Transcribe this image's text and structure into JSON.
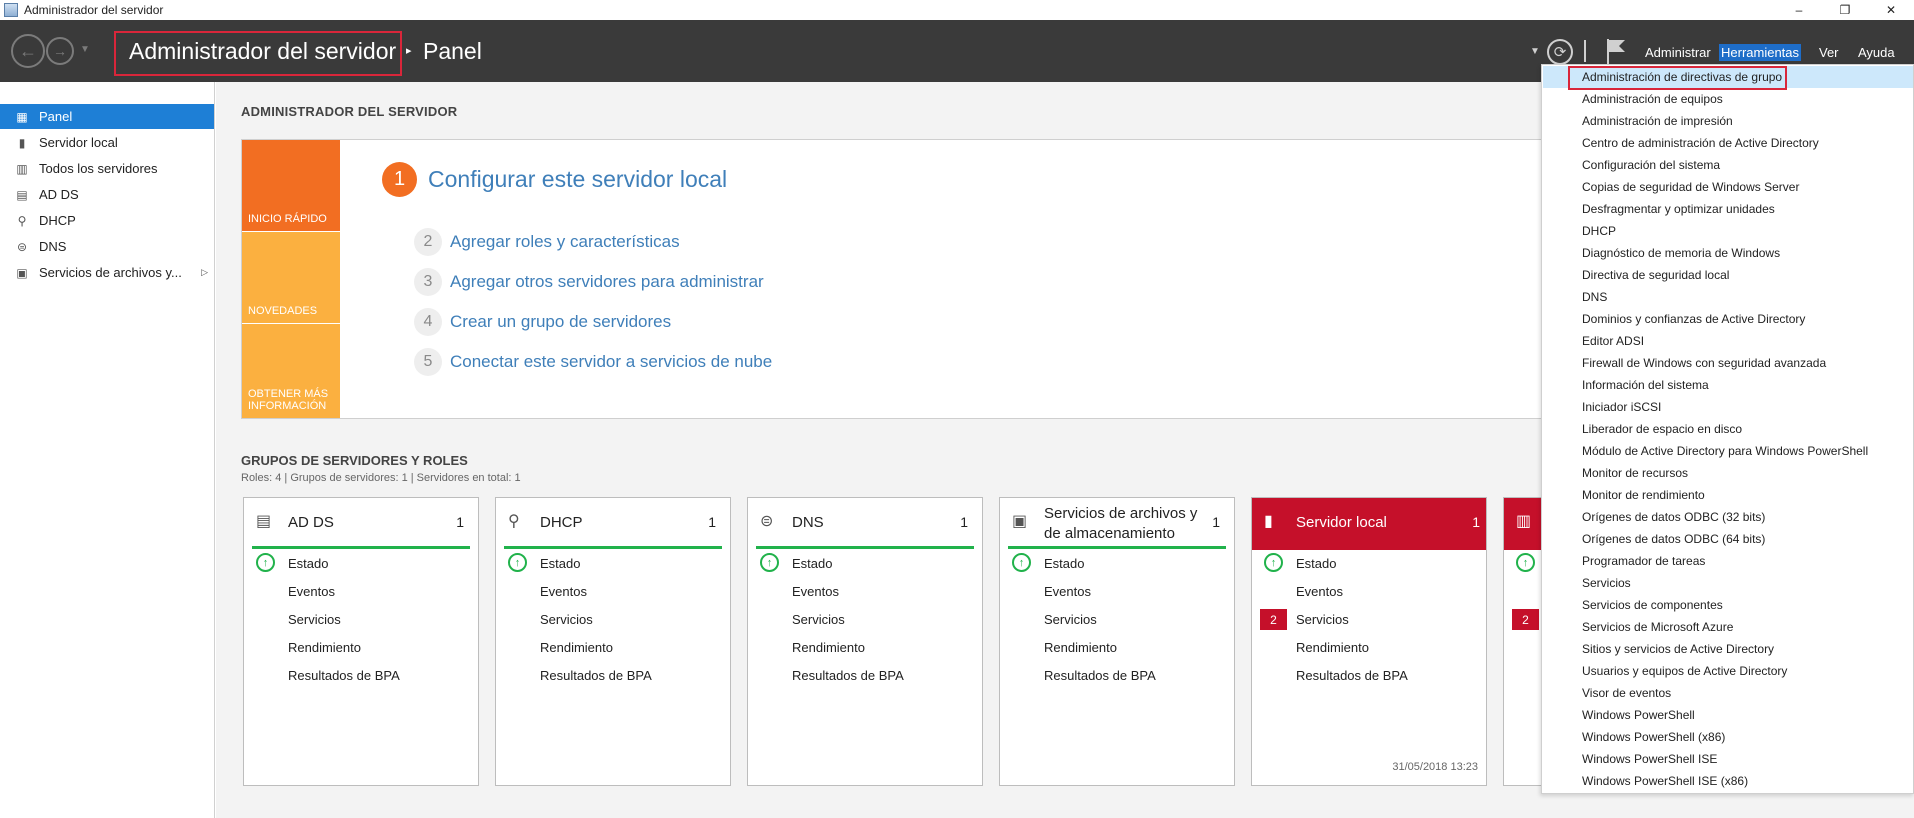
{
  "window": {
    "title": "Administrador del servidor",
    "min": "–",
    "restore": "❐",
    "close": "✕"
  },
  "header": {
    "breadcrumb_main": "Administrador del servidor",
    "breadcrumb_sep": "▸",
    "breadcrumb_current": "Panel",
    "menu": {
      "admin": "Administrar",
      "tools": "Herramientas",
      "view": "Ver",
      "help": "Ayuda"
    }
  },
  "sidebar": {
    "items": [
      {
        "label": "Panel",
        "icon": "panel-icon",
        "active": true
      },
      {
        "label": "Servidor local",
        "icon": "server-icon"
      },
      {
        "label": "Todos los servidores",
        "icon": "servers-icon"
      },
      {
        "label": "AD DS",
        "icon": "adds-icon"
      },
      {
        "label": "DHCP",
        "icon": "dhcp-icon"
      },
      {
        "label": "DNS",
        "icon": "dns-icon"
      },
      {
        "label": "Servicios de archivos y...",
        "icon": "files-icon",
        "chevron": "▷"
      }
    ]
  },
  "main": {
    "title": "ADMINISTRADOR DEL SERVIDOR",
    "quickstart": {
      "tabs": [
        "INICIO RÁPIDO",
        "NOVEDADES",
        "OBTENER MÁS INFORMACIÓN"
      ],
      "step1": {
        "num": "1",
        "text": "Configurar este servidor local"
      },
      "steps": [
        {
          "num": "2",
          "text": "Agregar roles y características"
        },
        {
          "num": "3",
          "text": "Agregar otros servidores para administrar"
        },
        {
          "num": "4",
          "text": "Crear un grupo de servidores"
        },
        {
          "num": "5",
          "text": "Conectar este servidor a servicios de nube"
        }
      ]
    },
    "groups": {
      "title": "GRUPOS DE SERVIDORES Y ROLES",
      "subtitle": "Roles: 4   |   Grupos de servidores: 1   |   Servidores en total: 1"
    },
    "tiles": [
      {
        "name": "AD DS",
        "count": "1",
        "icon": "adds-icon"
      },
      {
        "name": "DHCP",
        "count": "1",
        "icon": "dhcp-icon"
      },
      {
        "name": "DNS",
        "count": "1",
        "icon": "dns-icon"
      },
      {
        "name": "Servicios de archivos y de almacenamiento",
        "count": "1",
        "icon": "files-icon"
      },
      {
        "name": "Servidor local",
        "count": "1",
        "icon": "server-icon",
        "services_badge": "2",
        "date": "31/05/2018 13:23"
      },
      {
        "name": "",
        "count": "",
        "icon": "servers-icon",
        "services_badge": "2"
      }
    ],
    "tile_rows": {
      "estado": "Estado",
      "eventos": "Eventos",
      "servicios": "Servicios",
      "rendimiento": "Rendimiento",
      "bpa": "Resultados de BPA"
    }
  },
  "tools_menu": [
    "Administración de directivas de grupo",
    "Administración de equipos",
    "Administración de impresión",
    "Centro de administración de Active Directory",
    "Configuración del sistema",
    "Copias de seguridad de Windows Server",
    "Desfragmentar y optimizar unidades",
    "DHCP",
    "Diagnóstico de memoria de Windows",
    "Directiva de seguridad local",
    "DNS",
    "Dominios y confianzas de Active Directory",
    "Editor ADSI",
    "Firewall de Windows con seguridad avanzada",
    "Información del sistema",
    "Iniciador iSCSI",
    "Liberador de espacio en disco",
    "Módulo de Active Directory para Windows PowerShell",
    "Monitor de recursos",
    "Monitor de rendimiento",
    "Orígenes de datos ODBC (32 bits)",
    "Orígenes de datos ODBC (64 bits)",
    "Programador de tareas",
    "Servicios",
    "Servicios de componentes",
    "Servicios de Microsoft Azure",
    "Sitios y servicios de Active Directory",
    "Usuarios y equipos de Active Directory",
    "Visor de eventos",
    "Windows PowerShell",
    "Windows PowerShell (x86)",
    "Windows PowerShell ISE",
    "Windows PowerShell ISE (x86)"
  ],
  "colors": {
    "header": "#3a3a3a",
    "accent": "#1e7fd6",
    "orange": "#f26e22",
    "amber": "#fbb040",
    "red": "#c5102a",
    "green": "#21b24b",
    "highlight": "#d9263a"
  }
}
